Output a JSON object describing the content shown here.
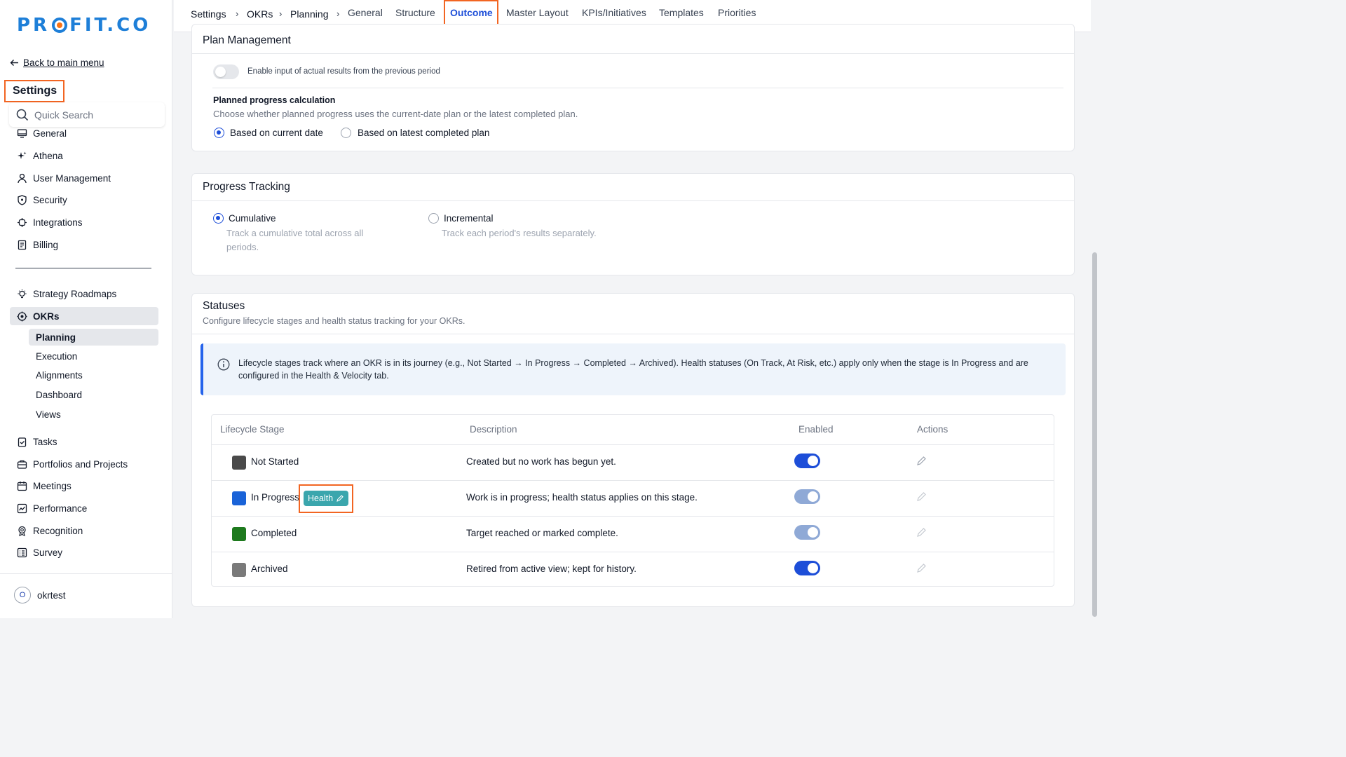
{
  "sidebar": {
    "logo_text": "PR●FIT.CO",
    "back_label": "Back to main menu",
    "settings_title": "Settings",
    "search_placeholder": "Quick Search",
    "items": [
      {
        "label": "General",
        "icon": "monitor-icon"
      },
      {
        "label": "Athena",
        "icon": "sparkle-icon"
      },
      {
        "label": "User Management",
        "icon": "user-icon"
      },
      {
        "label": "Security",
        "icon": "shield-icon"
      },
      {
        "label": "Integrations",
        "icon": "chip-icon"
      },
      {
        "label": "Billing",
        "icon": "receipt-icon"
      }
    ],
    "items2": [
      {
        "label": "Strategy Roadmaps",
        "icon": "lightbulb-icon"
      },
      {
        "label": "OKRs",
        "icon": "target-icon",
        "active": true
      }
    ],
    "okr_sub": [
      "Planning",
      "Execution",
      "Alignments",
      "Dashboard",
      "Views"
    ],
    "items3": [
      {
        "label": "Tasks",
        "icon": "clipboard-check-icon"
      },
      {
        "label": "Portfolios and Projects",
        "icon": "briefcase-icon"
      },
      {
        "label": "Meetings",
        "icon": "calendar-icon"
      },
      {
        "label": "Performance",
        "icon": "chart-icon"
      },
      {
        "label": "Recognition",
        "icon": "award-icon"
      },
      {
        "label": "Survey",
        "icon": "survey-icon"
      }
    ],
    "user": {
      "initial": "O",
      "name": "okrtest"
    }
  },
  "topbar": {
    "breadcrumbs": [
      "Settings",
      "OKRs",
      "Planning"
    ],
    "tabs": [
      "General",
      "Structure",
      "Outcome",
      "Master Layout",
      "KPIs/Initiatives",
      "Templates",
      "Priorities"
    ],
    "active_tab": "Outcome"
  },
  "plan_management": {
    "title": "Plan Management",
    "toggle_label": "Enable input of actual results from the previous period",
    "toggle_on": false,
    "calc_title": "Planned progress calculation",
    "calc_desc": "Choose whether planned progress uses the current-date plan or the latest completed plan.",
    "options": [
      "Based on current date",
      "Based on latest completed plan"
    ],
    "selected": 0
  },
  "progress_tracking": {
    "title": "Progress Tracking",
    "options": [
      {
        "label": "Cumulative",
        "desc_line1": "Track a cumulative total across all",
        "desc_line2": "periods.",
        "selected": true
      },
      {
        "label": "Incremental",
        "desc_line1": "Track each period's results separately.",
        "desc_line2": "",
        "selected": false
      }
    ]
  },
  "statuses": {
    "title": "Statuses",
    "subtitle": "Configure lifecycle stages and health status tracking for your OKRs.",
    "info": "Lifecycle stages track where an OKR is in its journey (e.g., Not Started → In Progress → Completed → Archived). Health statuses (On Track, At Risk, etc.) apply only when the stage is In Progress and are configured in the Health & Velocity tab.",
    "columns": [
      "Lifecycle Stage",
      "Description",
      "Enabled",
      "Actions"
    ],
    "health_chip": "Health",
    "rows": [
      {
        "stage": "Not Started",
        "color": "#4a4a4a",
        "description": "Created but no work has begun yet.",
        "enabled": true
      },
      {
        "stage": "In Progress",
        "color": "#1a63d8",
        "description": "Work is in progress; health status applies on this stage.",
        "enabled": true
      },
      {
        "stage": "Completed",
        "color": "#1e7a1e",
        "description": "Target reached or marked complete.",
        "enabled": true
      },
      {
        "stage": "Archived",
        "color": "#7a7a7a",
        "description": "Retired from active view; kept for history.",
        "enabled": true
      }
    ]
  }
}
